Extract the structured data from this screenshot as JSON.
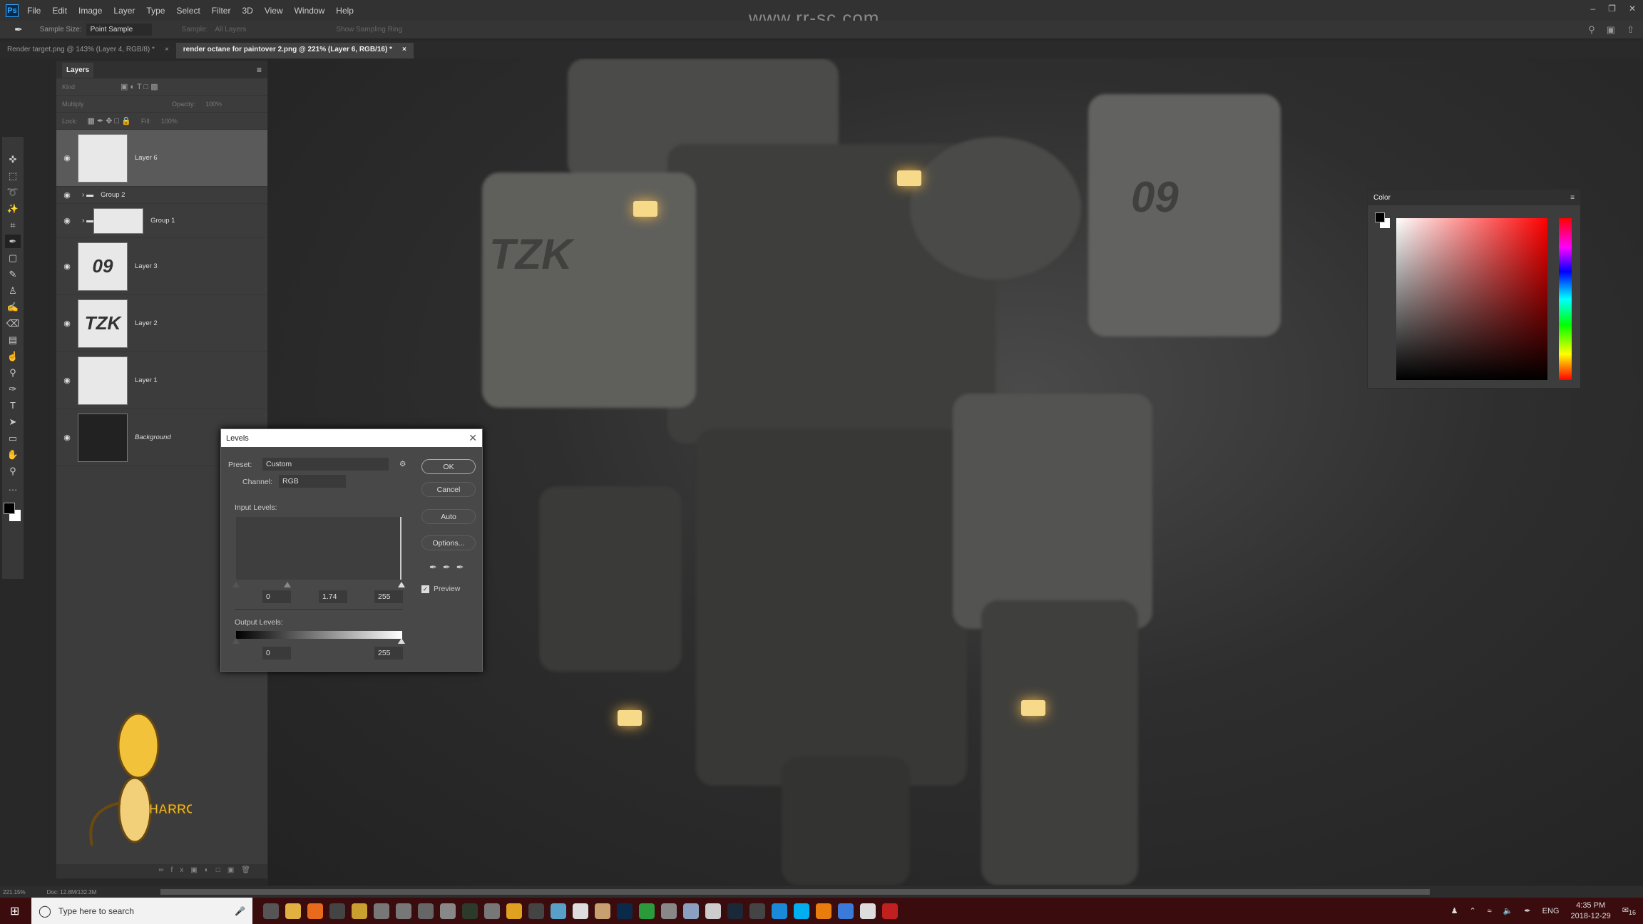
{
  "menubar": {
    "logo": "Ps",
    "items": [
      "File",
      "Edit",
      "Image",
      "Layer",
      "Type",
      "Select",
      "Filter",
      "3D",
      "View",
      "Window",
      "Help"
    ],
    "watermark": "www.rr-sc.com"
  },
  "options": {
    "sample_size_label": "Sample Size:",
    "sample_size_value": "Point Sample",
    "sample_label": "Sample:",
    "sample_value": "All Layers",
    "show_ring": "Show Sampling Ring"
  },
  "tabs": [
    {
      "label": "Render target.png @ 143% (Layer 4, RGB/8) *",
      "active": false
    },
    {
      "label": "render octane for paintover 2.png @ 221% (Layer 6, RGB/16) *",
      "active": true
    }
  ],
  "tools": [
    "move-icon",
    "marquee-icon",
    "lasso-icon",
    "magic-wand-icon",
    "crop-icon",
    "eyedropper-icon",
    "frame-icon",
    "brush-icon",
    "stamp-icon",
    "history-brush-icon",
    "eraser-icon",
    "gradient-icon",
    "smudge-icon",
    "dodge-icon",
    "pen-icon",
    "type-icon",
    "path-select-icon",
    "shape-icon",
    "hand-icon",
    "zoom-icon",
    "more-icon"
  ],
  "layers": {
    "title": "Layers",
    "kind": "Kind",
    "blend": "Multiply",
    "opacity_label": "Opacity:",
    "opacity": "100%",
    "lock_label": "Lock:",
    "fill_label": "Fill:",
    "fill": "100%",
    "items": [
      {
        "name": "Layer 6",
        "selected": true
      },
      {
        "name": "Group 2",
        "group": true
      },
      {
        "name": "Group 1",
        "group": true
      },
      {
        "name": "Layer 3",
        "thumb": "09"
      },
      {
        "name": "Layer 2",
        "thumb": "TZK"
      },
      {
        "name": "Layer 1"
      },
      {
        "name": "Background"
      }
    ]
  },
  "levels": {
    "title": "Levels",
    "preset_label": "Preset:",
    "preset": "Custom",
    "channel_label": "Channel:",
    "channel": "RGB",
    "input_label": "Input Levels:",
    "input_black": "0",
    "input_gamma": "1.74",
    "input_white": "255",
    "output_label": "Output Levels:",
    "output_black": "0",
    "output_white": "255",
    "ok": "OK",
    "cancel": "Cancel",
    "auto": "Auto",
    "options": "Options...",
    "preview": "Preview",
    "preview_checked": true
  },
  "color_panel": {
    "title": "Color",
    "hue_color": "#ff0000"
  },
  "canvas": {
    "decal_left": "TZK",
    "decal_right": "09"
  },
  "status": {
    "zoom": "221.15%",
    "doc": "Doc: 12.8M/132.3M"
  },
  "taskbar": {
    "search_placeholder": "Type here to search",
    "apps": [
      {
        "icon": "task-view-icon",
        "color": "#555"
      },
      {
        "icon": "file-explorer-icon",
        "color": "#e0b040"
      },
      {
        "icon": "firefox-icon",
        "color": "#e86a1c"
      },
      {
        "icon": "obs-icon",
        "color": "#444"
      },
      {
        "icon": "app-icon",
        "color": "#c9a030"
      },
      {
        "icon": "app-icon",
        "color": "#777"
      },
      {
        "icon": "app-icon",
        "color": "#777"
      },
      {
        "icon": "app-icon",
        "color": "#666"
      },
      {
        "icon": "app-icon",
        "color": "#888"
      },
      {
        "icon": "daz-studio-icon",
        "color": "#2c3a2c"
      },
      {
        "icon": "chrome-icon",
        "color": "#777"
      },
      {
        "icon": "mari-icon",
        "color": "#e0a020"
      },
      {
        "icon": "app-icon",
        "color": "#444"
      },
      {
        "icon": "app-icon",
        "color": "#58a0c8"
      },
      {
        "icon": "app-icon",
        "color": "#ddd"
      },
      {
        "icon": "app-icon",
        "color": "#c8a070"
      },
      {
        "icon": "photoshop-icon",
        "color": "#0b2a4a"
      },
      {
        "icon": "app-icon",
        "color": "#2a9a3a"
      },
      {
        "icon": "app-icon",
        "color": "#888"
      },
      {
        "icon": "app-icon",
        "color": "#8aa0c0"
      },
      {
        "icon": "app-icon",
        "color": "#ccc"
      },
      {
        "icon": "steam-icon",
        "color": "#1b2838"
      },
      {
        "icon": "app-icon",
        "color": "#444"
      },
      {
        "icon": "app-icon",
        "color": "#1a8ad8"
      },
      {
        "icon": "skype-icon",
        "color": "#00aff0"
      },
      {
        "icon": "blender-icon",
        "color": "#e87d0d"
      },
      {
        "icon": "app-icon",
        "color": "#3a7ad8"
      },
      {
        "icon": "app-icon",
        "color": "#ddd"
      },
      {
        "icon": "app-icon",
        "color": "#c02020"
      }
    ],
    "tray": {
      "lang": "ENG",
      "time": "4:35 PM",
      "date": "2018-12-29",
      "notifications": "16"
    }
  }
}
